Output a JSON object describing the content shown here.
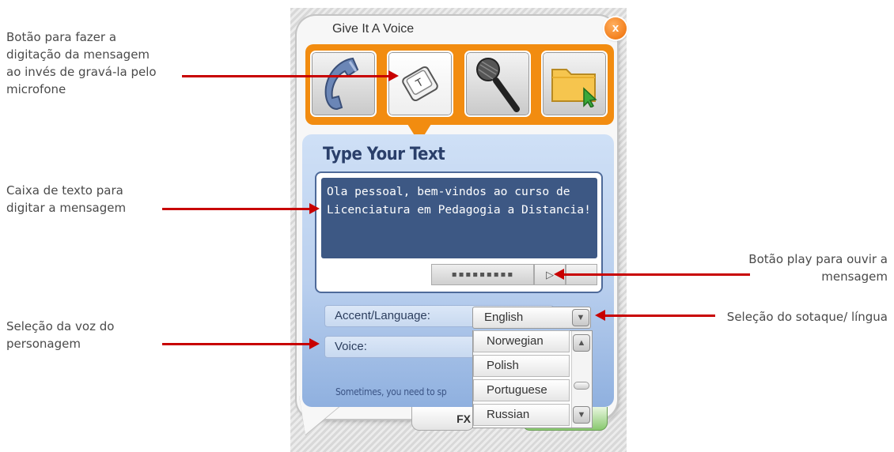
{
  "annotations": {
    "type_button": "Botão para fazer a digitação da mensagem ao invés de gravá-la pelo microfone",
    "text_box": "Caixa de texto para digitar a mensagem",
    "voice_select": "Seleção da voz do personagem",
    "play_button": "Botão play para ouvir a mensagem",
    "accent_select": "Seleção do sotaque/ língua"
  },
  "widget": {
    "title": "Give It A Voice",
    "close_glyph": "x",
    "modes": [
      {
        "name": "phone",
        "icon": "phone-icon"
      },
      {
        "name": "type",
        "icon": "keyboard-key-icon",
        "active": true
      },
      {
        "name": "microphone",
        "icon": "microphone-icon"
      },
      {
        "name": "upload",
        "icon": "folder-icon"
      }
    ],
    "section_heading": "Type Your Text",
    "message": "Ola pessoal, bem-vindos ao curso de Licenciatura em Pedagogia a Distancia!",
    "progress_glyph": "▪▪▪▪▪▪▪▪▪",
    "play_glyph": "▷",
    "accent_label": "Accent/Language:",
    "accent_value": "English",
    "voice_label": "Voice:",
    "voice_options": [
      "Norwegian",
      "Polish",
      "Portuguese",
      "Russian"
    ],
    "hint": "Sometimes, you need to sp",
    "fx_label": "FX",
    "arrow_down": "▼",
    "arrow_up": "▲"
  },
  "colors": {
    "accent_orange": "#f28c10",
    "arrow_red": "#c80000",
    "text_area": "#3d5884",
    "panel_blue": "#b9cfee"
  }
}
